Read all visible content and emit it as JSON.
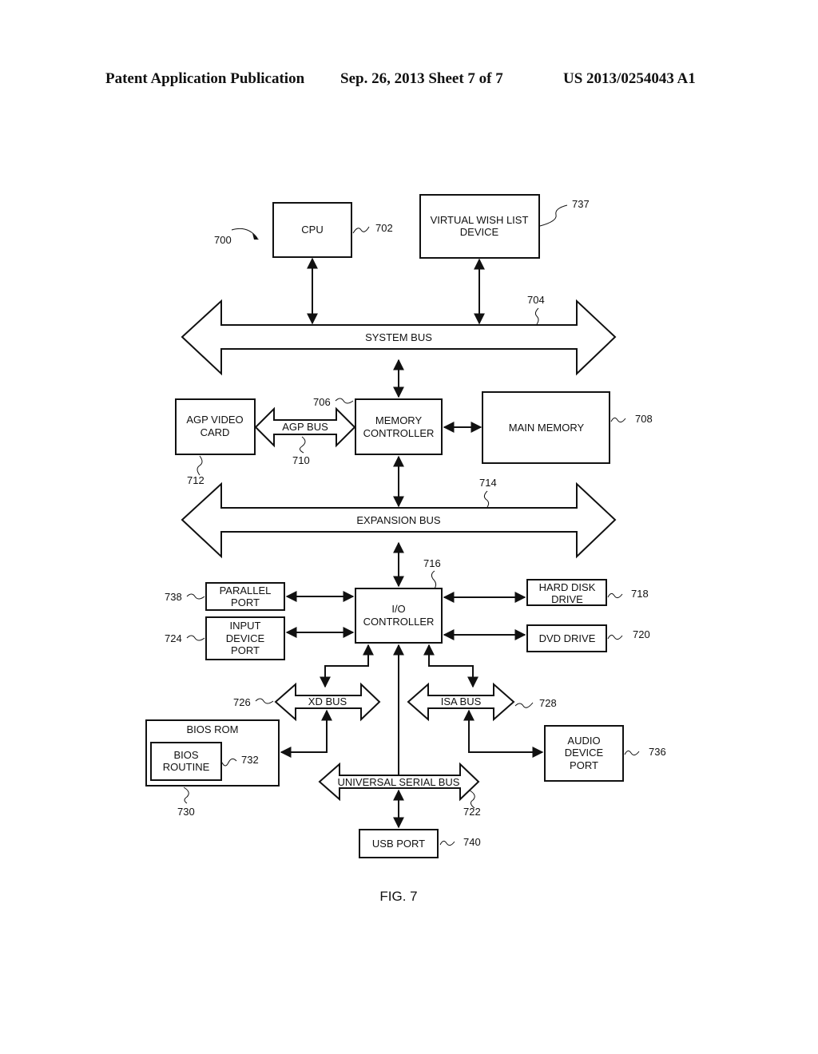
{
  "header": {
    "publication": "Patent Application Publication",
    "date_sheet": "Sep. 26, 2013   Sheet 7 of 7",
    "number": "US 2013/0254043 A1"
  },
  "figure": {
    "caption": "FIG. 7",
    "system_ref": "700",
    "blocks": {
      "cpu": {
        "label": "CPU",
        "ref": "702"
      },
      "wish": {
        "line1": "VIRTUAL WISH LIST",
        "line2": "DEVICE",
        "ref": "737"
      },
      "agp_card": {
        "line1": "AGP VIDEO",
        "line2": "CARD",
        "ref": "712"
      },
      "mem_ctrl": {
        "line1": "MEMORY",
        "line2": "CONTROLLER",
        "ref": "706"
      },
      "main_mem": {
        "label": "MAIN MEMORY",
        "ref": "708"
      },
      "io_ctrl": {
        "line1": "I/O",
        "line2": "CONTROLLER",
        "ref": "716"
      },
      "parallel": {
        "line1": "PARALLEL",
        "line2": "PORT",
        "ref": "738"
      },
      "input": {
        "line1": "INPUT",
        "line2": "DEVICE",
        "line3": "PORT",
        "ref": "724"
      },
      "hdd": {
        "line1": "HARD DISK",
        "line2": "DRIVE",
        "ref": "718"
      },
      "dvd": {
        "label": "DVD DRIVE",
        "ref": "720"
      },
      "bios_rom": {
        "label": "BIOS ROM",
        "ref": "730"
      },
      "bios_routine": {
        "line1": "BIOS",
        "line2": "ROUTINE",
        "ref": "732"
      },
      "audio": {
        "line1": "AUDIO",
        "line2": "DEVICE",
        "line3": "PORT",
        "ref": "736"
      },
      "usb_port": {
        "label": "USB PORT",
        "ref": "740"
      }
    },
    "buses": {
      "system": {
        "label": "SYSTEM BUS",
        "ref": "704"
      },
      "expansion": {
        "label": "EXPANSION BUS",
        "ref": "714"
      },
      "agp": {
        "label": "AGP BUS",
        "ref": "710"
      },
      "xd": {
        "label": "XD BUS",
        "ref": "726"
      },
      "isa": {
        "label": "ISA BUS",
        "ref": "728"
      },
      "usb": {
        "label": "UNIVERSAL SERIAL  BUS",
        "ref": "722"
      }
    }
  }
}
